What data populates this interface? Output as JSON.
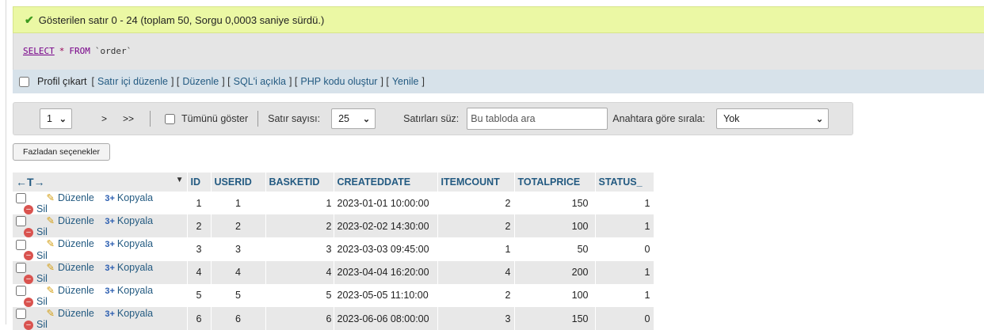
{
  "success": {
    "icon": "check-icon",
    "message": "Gösterilen satır 0 - 24 (toplam 50, Sorgu 0,0003 saniye sürdü.)"
  },
  "sql": {
    "select": "SELECT",
    "star": "*",
    "from": "FROM",
    "table": "`order`"
  },
  "links": {
    "profile_label": "Profil çıkart",
    "items": [
      "Satır içi düzenle",
      "Düzenle",
      "SQL'i açıkla",
      "PHP kodu oluştur",
      "Yenile"
    ]
  },
  "nav": {
    "page_value": "1",
    "next": ">",
    "last": ">>",
    "show_all_label": "Tümünü göster",
    "row_count_label": "Satır sayısı:",
    "row_count_value": "25",
    "filter_label": "Satırları süz:",
    "filter_placeholder": "Bu tabloda ara",
    "sort_label": "Anahtara göre sırala:",
    "sort_value": "Yok"
  },
  "more_options": "Fazladan seçenekler",
  "table": {
    "arrows": "←T→",
    "columns": [
      "ID",
      "USERID",
      "BASKETID",
      "CREATEDDATE",
      "ITEMCOUNT",
      "TOTALPRICE",
      "STATUS_"
    ],
    "actions": {
      "edit": "Düzenle",
      "copy": "Kopyala",
      "delete": "Sil"
    },
    "rows": [
      [
        "1",
        "1",
        "1",
        "2023-01-01 10:00:00",
        "2",
        "150",
        "1"
      ],
      [
        "2",
        "2",
        "2",
        "2023-02-02 14:30:00",
        "2",
        "100",
        "1"
      ],
      [
        "3",
        "3",
        "3",
        "2023-03-03 09:45:00",
        "1",
        "50",
        "0"
      ],
      [
        "4",
        "4",
        "4",
        "2023-04-04 16:20:00",
        "4",
        "200",
        "1"
      ],
      [
        "5",
        "5",
        "5",
        "2023-05-05 11:10:00",
        "2",
        "100",
        "1"
      ],
      [
        "6",
        "6",
        "6",
        "2023-06-06 08:00:00",
        "3",
        "150",
        "0"
      ]
    ]
  }
}
